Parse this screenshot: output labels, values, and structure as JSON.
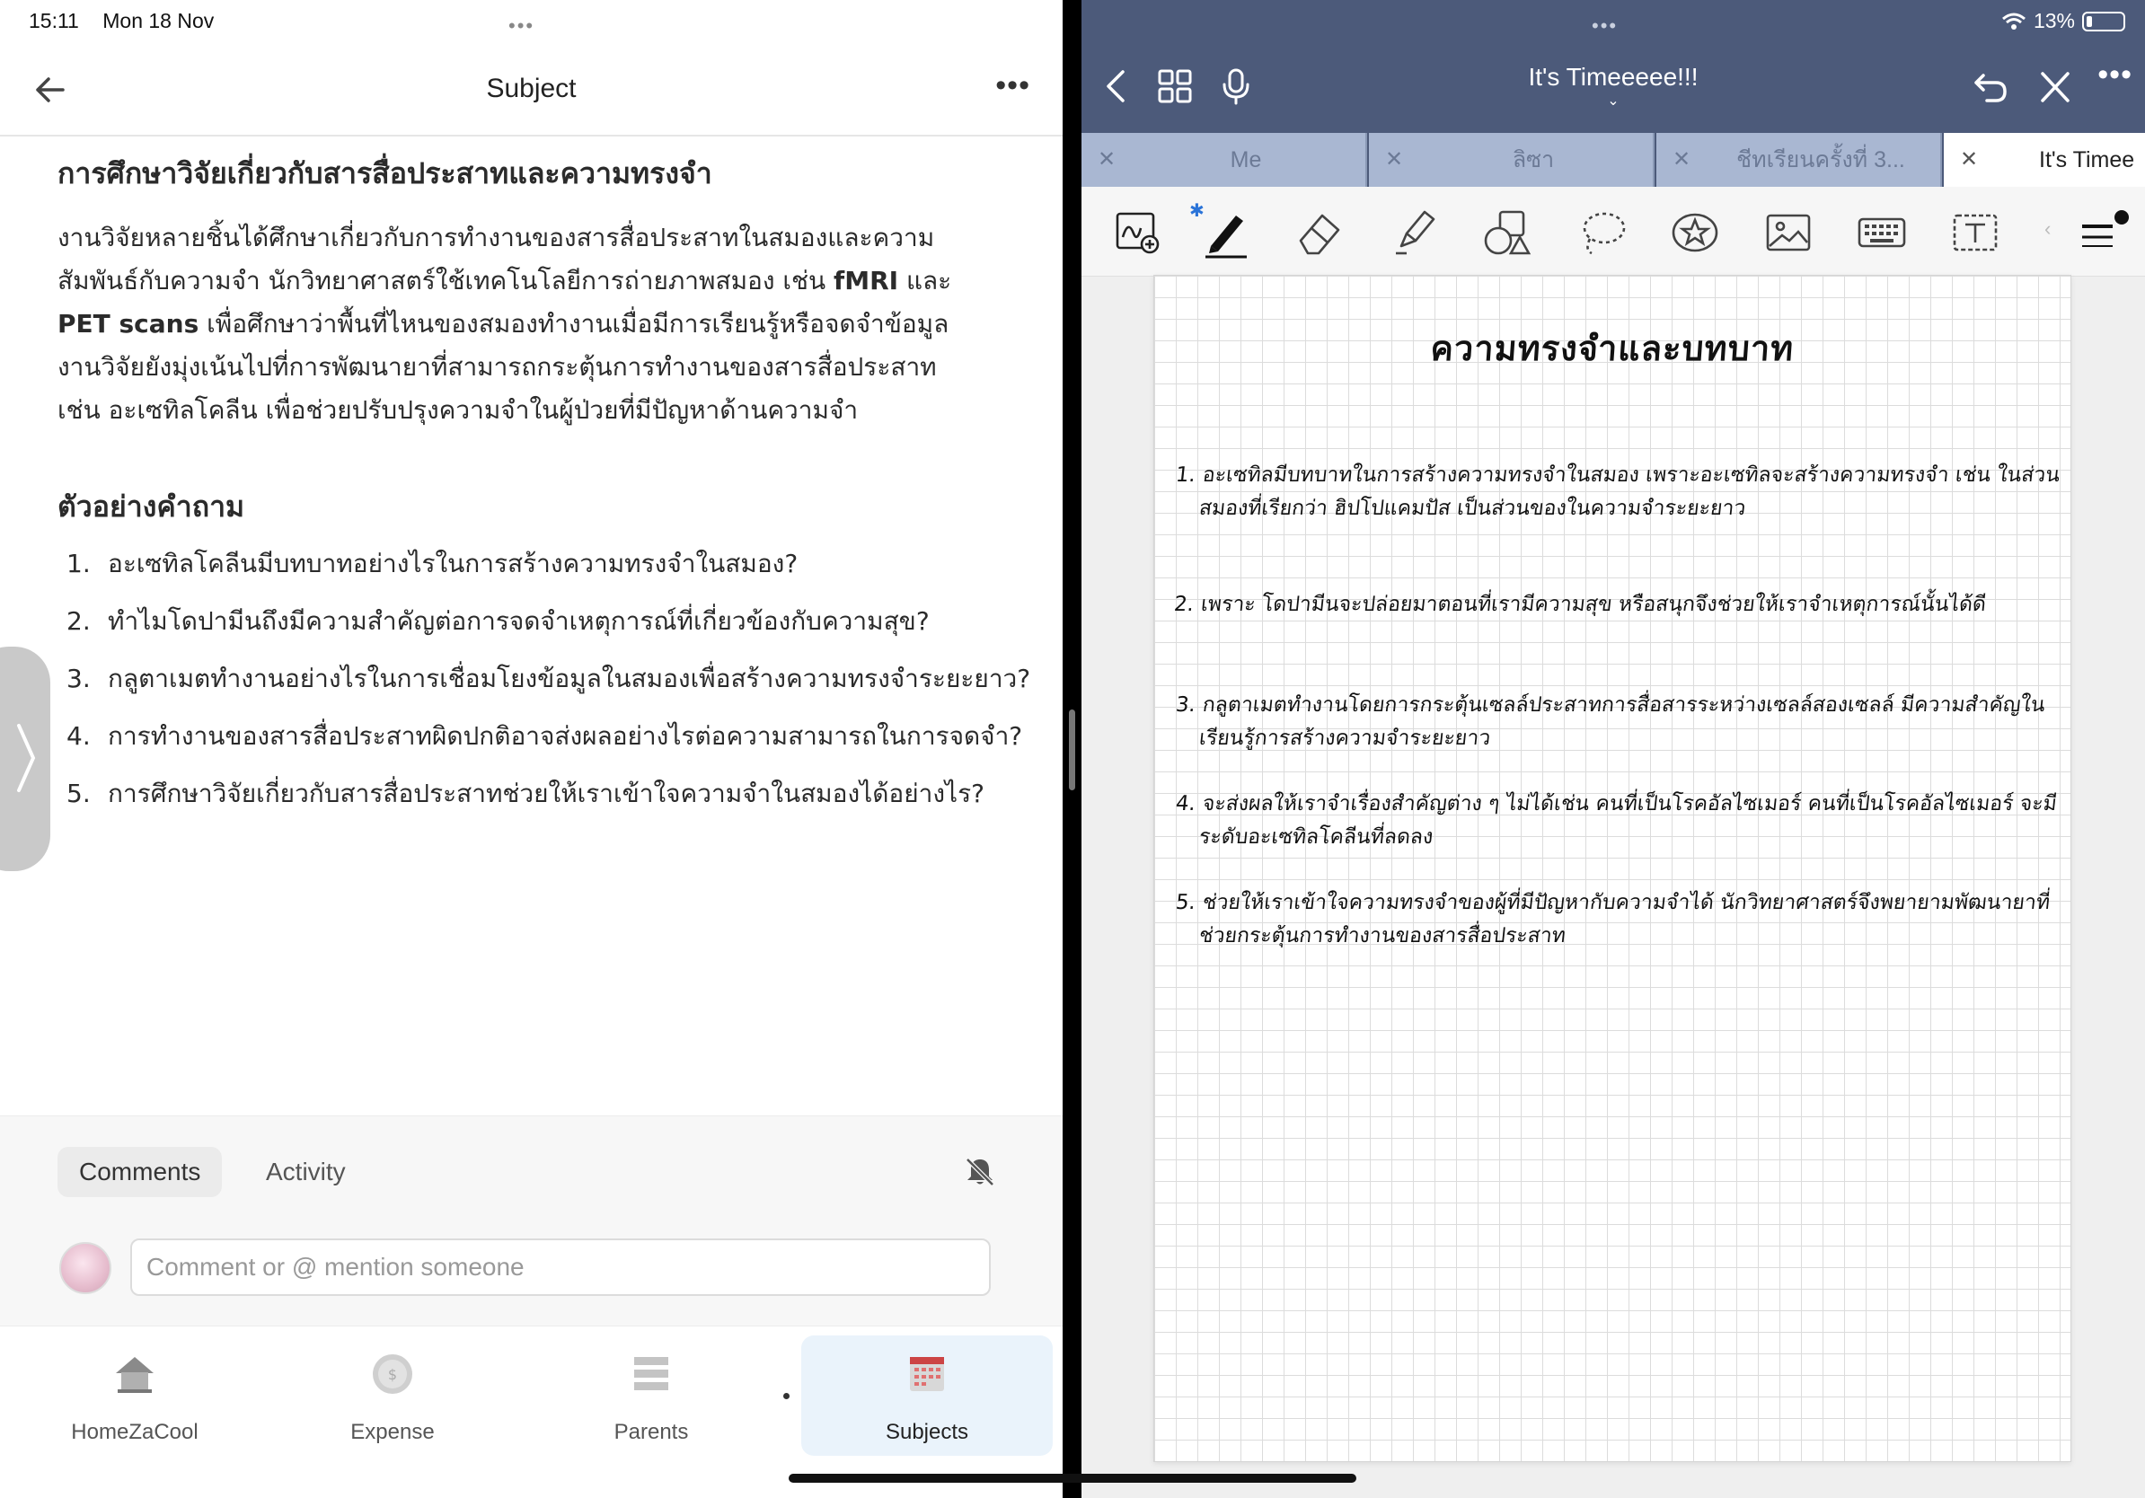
{
  "status": {
    "time": "15:11",
    "date": "Mon 18 Nov",
    "wifi": "wifi-icon",
    "battery": "13%"
  },
  "left": {
    "header": {
      "title": "Subject"
    },
    "article": {
      "heading": "การศึกษาวิจัยเกี่ยวกับสารสื่อประสาทและความทรงจำ",
      "para_line1": "งานวิจัยหลายชิ้นได้ศึกษาเกี่ยวกับการทำงานของสารสื่อประสาทในสมองและความ",
      "para_line2_a": "สัมพันธ์กับความจำ นักวิทยาศาสตร์ใช้เทคโนโลยีการถ่ายภาพสมอง เช่น ",
      "para_line2_b": "fMRI",
      "para_line2_c": " และ",
      "para_line3_a": "PET scans",
      "para_line3_b": " เพื่อศึกษาว่าพื้นที่ไหนของสมองทำงานเมื่อมีการเรียนรู้หรือจดจำข้อมูล",
      "para_line4": "งานวิจัยยังมุ่งเน้นไปที่การพัฒนายาที่สามารถกระตุ้นการทำงานของสารสื่อประสาท",
      "para_line5": "เช่น อะเซทิลโคลีน เพื่อช่วยปรับปรุงความจำในผู้ป่วยที่มีปัญหาด้านความจำ",
      "questions_heading": "ตัวอย่างคำถาม",
      "questions": [
        {
          "num": "1.",
          "text": "อะเซทิลโคลีนมีบทบาทอย่างไรในการสร้างความทรงจำในสมอง?"
        },
        {
          "num": "2.",
          "text": "ทำไมโดปามีนถึงมีความสำคัญต่อการจดจำเหตุการณ์ที่เกี่ยวข้องกับความสุข?"
        },
        {
          "num": "3.",
          "text": "กลูตาเมตทำงานอย่างไรในการเชื่อมโยงข้อมูลในสมองเพื่อสร้างความทรงจำระยะยาว?"
        },
        {
          "num": "4.",
          "text": "การทำงานของสารสื่อประสาทผิดปกติอาจส่งผลอย่างไรต่อความสามารถในการจดจำ?"
        },
        {
          "num": "5.",
          "text": "การศึกษาวิจัยเกี่ยวกับสารสื่อประสาทช่วยให้เราเข้าใจความจำในสมองได้อย่างไร?"
        }
      ]
    },
    "comments": {
      "tab_comments": "Comments",
      "tab_activity": "Activity",
      "input_placeholder": "Comment or @ mention someone"
    },
    "nav": [
      {
        "label": "HomeZaCool",
        "icon": "house-icon"
      },
      {
        "label": "Expense",
        "icon": "coin-icon"
      },
      {
        "label": "Parents",
        "icon": "stack-icon"
      },
      {
        "label": "Subjects",
        "icon": "calendar-icon",
        "active": true
      }
    ]
  },
  "right": {
    "doc_title": "It's Timeeeee!!!",
    "tabs": [
      {
        "label": "Me"
      },
      {
        "label": "ลิซา"
      },
      {
        "label": "ชีทเรียนครั้งที่ 3..."
      },
      {
        "label": "It's Timee",
        "active": true
      }
    ],
    "note": {
      "title": "ความทรงจำและบทบาท",
      "items": [
        {
          "num": "1.",
          "text": "อะเซทิลมีบทบาทในการสร้างความทรงจำในสมอง เพราะอะเซทิลจะสร้างความทรงจำ เช่น ในส่วนสมองที่เรียกว่า ฮิปโปแคมปัส เป็นส่วนของในความจำระยะยาว"
        },
        {
          "num": "2.",
          "text": "เพราะ โดปามีนจะปล่อยมาตอนที่เรามีความสุข หรือสนุกจึงช่วยให้เราจำเหตุการณ์นั้นได้ดี"
        },
        {
          "num": "3.",
          "text": "กลูตาเมตทำงานโดยการกระตุ้นเซลล์ประสาทการสื่อสารระหว่างเซลล์สองเซลล์ มีความสำคัญในเรียนรู้การสร้างความจำระยะยาว"
        },
        {
          "num": "4.",
          "text": "จะส่งผลให้เราจำเรื่องสำคัญต่าง ๆ ไม่ได้เช่น คนที่เป็นโรคอัลไซเมอร์ คนที่เป็นโรคอัลไซเมอร์ จะมีระดับอะเซทิลโคลีนที่ลดลง"
        },
        {
          "num": "5.",
          "text": "ช่วยให้เราเข้าใจความทรงจำของผู้ที่มีปัญหากับความจำได้ นักวิทยาศาสตร์จึงพยายามพัฒนายาที่ช่วยกระตุ้นการทำงานของสารสื่อประสาท"
        }
      ]
    },
    "colors": {
      "header": "#4c5a7a",
      "tab_inactive": "#a9b7d2",
      "nav_active_bg": "#eaf3fb",
      "pen_accent": "#2a73d8"
    }
  }
}
